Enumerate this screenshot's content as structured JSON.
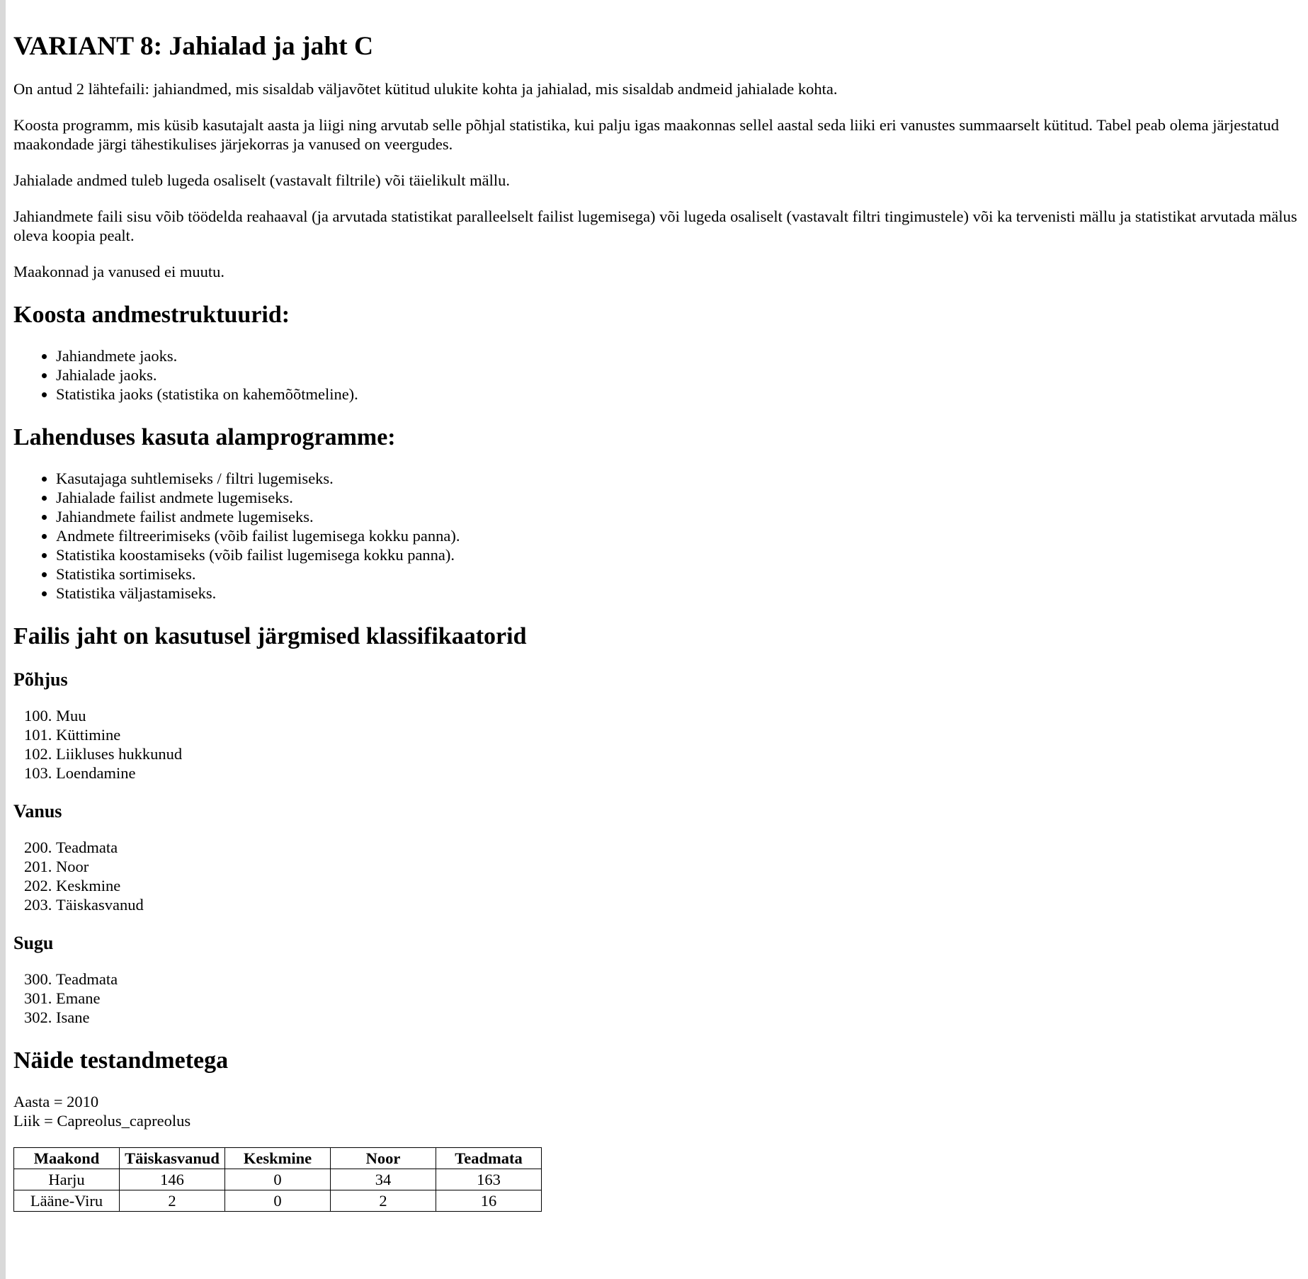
{
  "title": "VARIANT 8: Jahialad ja jaht C",
  "intro_paragraphs": [
    "On antud 2 lähtefaili: jahiandmed, mis sisaldab väljavõtet kütitud ulukite kohta ja jahialad, mis sisaldab andmeid jahialade kohta.",
    "Koosta programm, mis küsib kasutajalt aasta ja liigi ning arvutab selle põhjal statistika, kui palju igas maakonnas sellel aastal seda liiki eri vanustes summaarselt kütitud. Tabel peab olema järjestatud maakondade järgi tähestikulises järjekorras ja vanused on veergudes.",
    "Jahialade andmed tuleb lugeda osaliselt (vastavalt filtrile) või täielikult mällu.",
    "Jahiandmete faili sisu võib töödelda reahaaval (ja arvutada statistikat paralleelselt failist lugemisega) või lugeda osaliselt (vastavalt filtri tingimustele) või ka tervenisti mällu ja statistikat arvutada mälus oleva koopia pealt.",
    "Maakonnad ja vanused ei muutu."
  ],
  "structures": {
    "heading": "Koosta andmestruktuurid:",
    "items": [
      "Jahiandmete jaoks.",
      "Jahialade jaoks.",
      "Statistika jaoks (statistika on kahemõõtmeline)."
    ]
  },
  "subprograms": {
    "heading": "Lahenduses kasuta alamprogramme:",
    "items": [
      "Kasutajaga suhtlemiseks / filtri lugemiseks.",
      "Jahialade failist andmete lugemiseks.",
      "Jahiandmete failist andmete lugemiseks.",
      "Andmete filtreerimiseks (võib failist lugemisega kokku panna).",
      "Statistika koostamiseks (võib failist lugemisega kokku panna).",
      "Statistika sortimiseks.",
      "Statistika väljastamiseks."
    ]
  },
  "classifiers": {
    "heading": "Failis jaht on kasutusel järgmised klassifikaatorid",
    "groups": [
      {
        "name": "Põhjus",
        "start": 100,
        "items": [
          "Muu",
          "Küttimine",
          "Liikluses hukkunud",
          "Loendamine"
        ]
      },
      {
        "name": "Vanus",
        "start": 200,
        "items": [
          "Teadmata",
          "Noor",
          "Keskmine",
          "Täiskasvanud"
        ]
      },
      {
        "name": "Sugu",
        "start": 300,
        "items": [
          "Teadmata",
          "Emane",
          "Isane"
        ]
      }
    ]
  },
  "example": {
    "heading": "Näide testandmetega",
    "year_line": "Aasta = 2010",
    "species_line": "Liik = Capreolus_capreolus",
    "table": {
      "headers": [
        "Maakond",
        "Täiskasvanud",
        "Keskmine",
        "Noor",
        "Teadmata"
      ],
      "rows": [
        [
          "Harju",
          "146",
          "0",
          "34",
          "163"
        ],
        [
          "Lääne-Viru",
          "2",
          "0",
          "2",
          "16"
        ]
      ]
    }
  }
}
